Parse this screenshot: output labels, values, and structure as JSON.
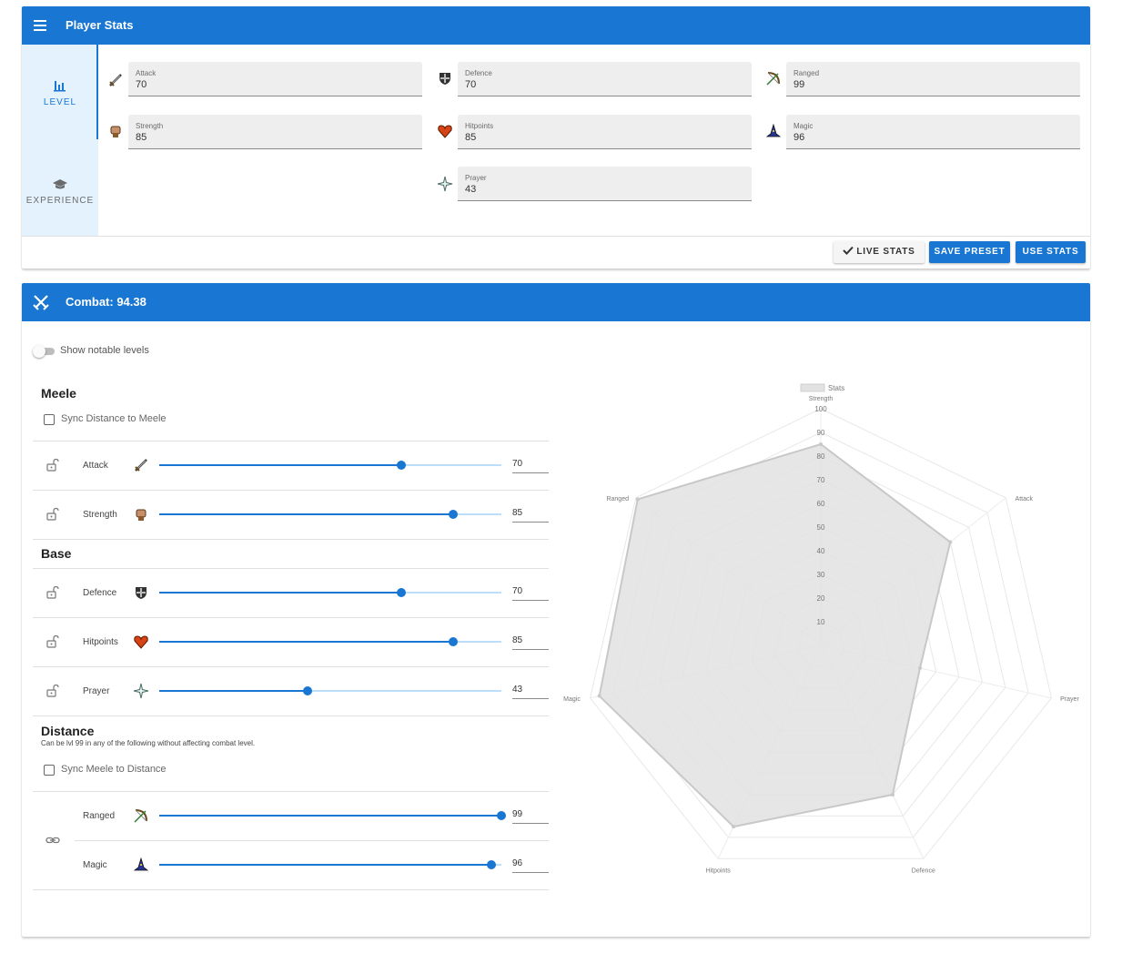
{
  "player_stats": {
    "title": "Player Stats",
    "menu_icon": "hamburger-menu-icon",
    "tabs": [
      {
        "label": "LEVEL",
        "icon": "bar-chart-icon",
        "active": true
      },
      {
        "label": "EXPERIENCE",
        "icon": "graduation-cap-icon",
        "active": false
      }
    ],
    "fields": {
      "attack": {
        "label": "Attack",
        "value": "70",
        "icon": "sword-icon"
      },
      "defence": {
        "label": "Defence",
        "value": "70",
        "icon": "shield-icon"
      },
      "ranged": {
        "label": "Ranged",
        "value": "99",
        "icon": "bow-icon"
      },
      "strength": {
        "label": "Strength",
        "value": "85",
        "icon": "fist-icon"
      },
      "hitpoints": {
        "label": "Hitpoints",
        "value": "85",
        "icon": "heart-icon"
      },
      "magic": {
        "label": "Magic",
        "value": "96",
        "icon": "wizard-hat-icon"
      },
      "prayer": {
        "label": "Prayer",
        "value": "43",
        "icon": "prayer-star-icon"
      }
    },
    "buttons": {
      "live_stats": "LIVE STATS",
      "save_preset": "SAVE PRESET",
      "use_stats": "USE STATS"
    }
  },
  "combat": {
    "title": "Combat: 94.38",
    "icon": "crossed-swords-icon",
    "toggle_label": "Show notable levels",
    "toggle_on": false,
    "sections": {
      "meele": {
        "title": "Meele",
        "sync_label": "Sync Distance to Meele"
      },
      "base": {
        "title": "Base"
      },
      "distance": {
        "title": "Distance",
        "note": "Can be lvl 99 in any of the following without affecting combat level.",
        "sync_label": "Sync Meele to Distance"
      }
    },
    "rows": {
      "attack": {
        "label": "Attack",
        "value": 70
      },
      "strength": {
        "label": "Strength",
        "value": 85
      },
      "defence": {
        "label": "Defence",
        "value": 70
      },
      "hitpoints": {
        "label": "Hitpoints",
        "value": 85
      },
      "prayer": {
        "label": "Prayer",
        "value": 43
      },
      "ranged": {
        "label": "Ranged",
        "value": 99
      },
      "magic": {
        "label": "Magic",
        "value": 96
      }
    },
    "slider_max": 99
  },
  "chart_data": {
    "type": "radar",
    "legend": "Stats",
    "legend_position": "top",
    "labels": [
      "Strength",
      "Attack",
      "Prayer",
      "Defence",
      "Hitpoints",
      "Magic",
      "Ranged"
    ],
    "values": [
      85,
      70,
      43,
      70,
      85,
      96,
      99
    ],
    "ticks": [
      "10",
      "20",
      "30",
      "40",
      "50",
      "60",
      "70",
      "80",
      "90",
      "100"
    ],
    "rmin": 0,
    "rmax": 100,
    "series_color": "#c8c8c8",
    "fill_color": "#e2e2e2"
  },
  "colors": {
    "primary": "#1976d2",
    "tab_bg": "#e3f2fd",
    "field_bg": "#eeeeee"
  }
}
